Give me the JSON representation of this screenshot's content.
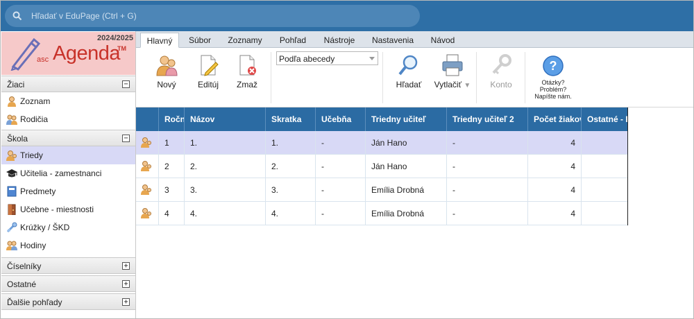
{
  "search": {
    "placeholder": "Hľadať v EduPage (Ctrl + G)"
  },
  "logo": {
    "year": "2024/2025",
    "asc": "asc",
    "agenda": "Agenda",
    "tm": "TM"
  },
  "sidebar": {
    "sections": [
      {
        "label": "Žiaci",
        "toggle": "−",
        "items": [
          {
            "label": "Zoznam",
            "icon": "student-icon"
          },
          {
            "label": "Rodičia",
            "icon": "parents-icon"
          }
        ]
      },
      {
        "label": "Škola",
        "toggle": "−",
        "items": [
          {
            "label": "Triedy",
            "icon": "class-icon",
            "selected": true
          },
          {
            "label": "Učitelia - zamestnanci",
            "icon": "graduation-cap-icon"
          },
          {
            "label": "Predmety",
            "icon": "book-icon"
          },
          {
            "label": "Učebne - miestnosti",
            "icon": "door-icon"
          },
          {
            "label": "Krúžky / ŠKD",
            "icon": "group-icon"
          },
          {
            "label": "Hodiny",
            "icon": "lessons-icon"
          }
        ]
      },
      {
        "label": "Číselníky",
        "toggle": "+"
      },
      {
        "label": "Ostatné",
        "toggle": "+"
      },
      {
        "label": "Ďalšie pohľady",
        "toggle": "+"
      }
    ]
  },
  "ribbon": {
    "tabs": [
      "Hlavný",
      "Súbor",
      "Zoznamy",
      "Pohľad",
      "Nástroje",
      "Nastavenia",
      "Návod"
    ],
    "active_tab": "Hlavný",
    "buttons": {
      "new": "Nový",
      "edit": "Editúj",
      "delete": "Zmaž",
      "search": "Hľadať",
      "print": "Vytlačiť",
      "account": "Konto"
    },
    "sort": {
      "value": "Podľa abecedy"
    },
    "help": {
      "line1": "Otázky?",
      "line2": "Problém?",
      "line3": "Napíšte nám."
    }
  },
  "table": {
    "columns": [
      "",
      "Ročník",
      "Názov",
      "Skratka",
      "Učebňa",
      "Triedny učiteľ",
      "Triedny učiteľ 2",
      "Počet žiakov",
      "Ostatné - Rozvrh"
    ],
    "rows": [
      {
        "rocnik": "1",
        "nazov": "1.",
        "skratka": "1.",
        "ucebna": "-",
        "ucitel": "Ján Hano",
        "ucitel2": "-",
        "pocet": "4",
        "selected": true
      },
      {
        "rocnik": "2",
        "nazov": "2.",
        "skratka": "2.",
        "ucebna": "-",
        "ucitel": "Ján Hano",
        "ucitel2": "-",
        "pocet": "4"
      },
      {
        "rocnik": "3",
        "nazov": "3.",
        "skratka": "3.",
        "ucebna": "-",
        "ucitel": "Emília Drobná",
        "ucitel2": "-",
        "pocet": "4"
      },
      {
        "rocnik": "4",
        "nazov": "4.",
        "skratka": "4.",
        "ucebna": "-",
        "ucitel": "Emília Drobná",
        "ucitel2": "-",
        "pocet": "4"
      }
    ]
  },
  "colors": {
    "topbar": "#2e6fa6",
    "header": "#2b6ba3",
    "selected_row": "#d8d9f6",
    "logo_bg": "#f6c9c9",
    "brand": "#c8322a"
  }
}
